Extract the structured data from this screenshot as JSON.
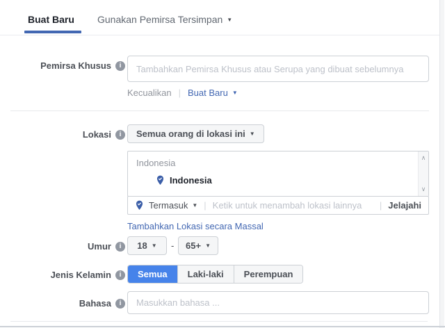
{
  "tabs": {
    "create_new": "Buat Baru",
    "use_saved": "Gunakan Pemirsa Tersimpan"
  },
  "custom_audience": {
    "label": "Pemirsa Khusus",
    "placeholder": "Tambahkan Pemirsa Khusus atau Serupa yang dibuat sebelumnya",
    "exclude_label": "Kecualikan",
    "create_new_link": "Buat Baru"
  },
  "location": {
    "label": "Lokasi",
    "dropdown_value": "Semua orang di lokasi ini",
    "list_header": "Indonesia",
    "selected_location": "Indonesia",
    "include_label": "Termasuk",
    "add_placeholder": "Ketik untuk menambah lokasi lainnya",
    "browse_label": "Jelajahi",
    "bulk_add_link": "Tambahkan Lokasi secara Massal"
  },
  "age": {
    "label": "Umur",
    "min_value": "18",
    "max_value": "65+",
    "separator": "-"
  },
  "gender": {
    "label": "Jenis Kelamin",
    "options": [
      "Semua",
      "Laki-laki",
      "Perempuan"
    ],
    "selected": "Semua"
  },
  "language": {
    "label": "Bahasa",
    "placeholder": "Masukkan bahasa ..."
  },
  "icons": {
    "info": "i",
    "caret_down": "▼",
    "chevron_up": "∧",
    "chevron_down": "∨",
    "separator": "|"
  },
  "colors": {
    "accent_blue": "#4267b2",
    "selected_segment_blue": "#4683ea",
    "link_blue": "#4267b2",
    "border_gray": "#ccd0d5",
    "label_gray": "#4b4f56",
    "placeholder_gray": "#bdc1c9"
  }
}
